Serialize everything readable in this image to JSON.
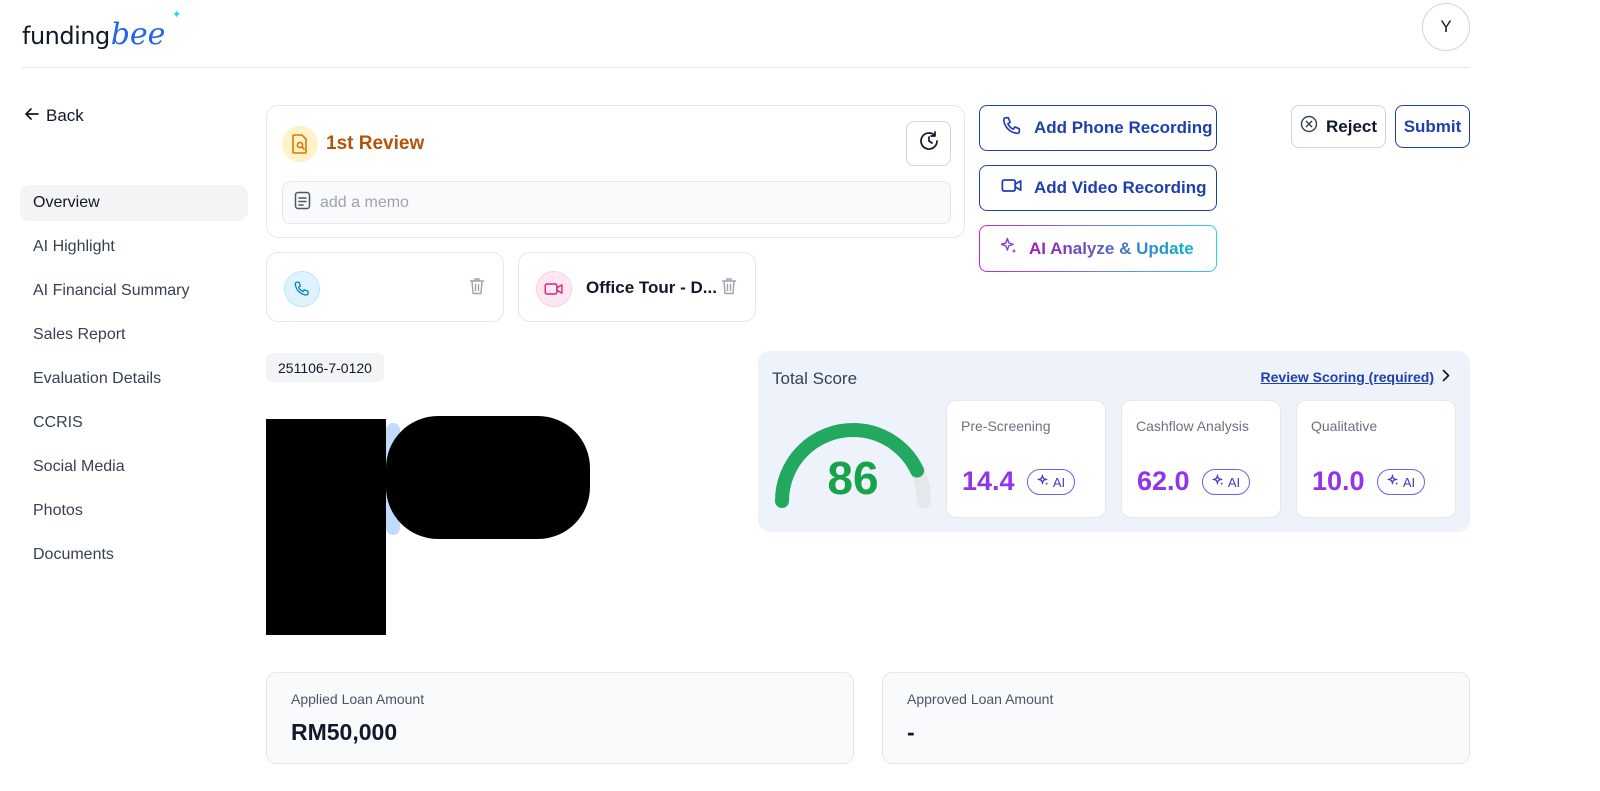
{
  "header": {
    "logo_word": "funding",
    "logo_script": "bee",
    "avatar_initial": "Y"
  },
  "sidebar": {
    "back_label": "Back",
    "items": [
      {
        "label": "Overview",
        "active": true
      },
      {
        "label": "AI Highlight"
      },
      {
        "label": "AI Financial Summary"
      },
      {
        "label": "Sales Report"
      },
      {
        "label": "Evaluation Details"
      },
      {
        "label": "CCRIS"
      },
      {
        "label": "Social Media"
      },
      {
        "label": "Photos"
      },
      {
        "label": "Documents"
      }
    ]
  },
  "review": {
    "title": "1st Review",
    "memo_placeholder": "add a memo",
    "memo_value": ""
  },
  "recordings": [
    {
      "type": "phone",
      "label": ""
    },
    {
      "type": "video",
      "label": "Office Tour - D..."
    }
  ],
  "actions": {
    "add_phone": "Add Phone Recording",
    "add_video": "Add Video Recording",
    "ai_analyze": "AI Analyze & Update",
    "reject": "Reject",
    "submit": "Submit"
  },
  "application": {
    "reference": "251106-7-0120"
  },
  "score": {
    "title": "Total Score",
    "link": "Review Scoring (required)",
    "total": "86",
    "total_fraction": 0.86,
    "items": [
      {
        "label": "Pre-Screening",
        "value": "14.4",
        "badge": "AI"
      },
      {
        "label": "Cashflow Analysis",
        "value": "62.0",
        "badge": "AI"
      },
      {
        "label": "Qualitative",
        "value": "10.0",
        "badge": "AI"
      }
    ]
  },
  "loan": {
    "applied_label": "Applied Loan Amount",
    "applied_value": "RM50,000",
    "approved_label": "Approved Loan Amount",
    "approved_value": "-"
  },
  "colors": {
    "primary": "#1e40af",
    "score_green": "#16a34a",
    "score_purple": "#9333ea",
    "review_amber": "#b45309"
  }
}
